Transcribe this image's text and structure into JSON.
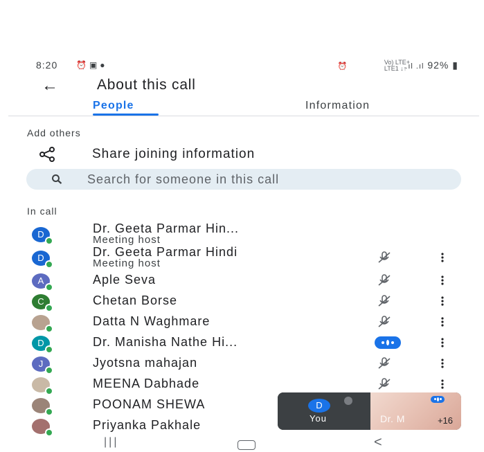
{
  "status_bar": {
    "time": "8:20",
    "left_icons": [
      "alarm-icon",
      "image-icon",
      "chat-icon"
    ],
    "network_top": "Vo) LTE+",
    "network_bottom": "LTE1 ↓↑",
    "battery": "92%"
  },
  "header": {
    "title": "About this call"
  },
  "tabs": [
    {
      "label": "People",
      "active": true
    },
    {
      "label": "Information",
      "active": false
    }
  ],
  "add_others": {
    "label": "Add others",
    "share_label": "Share joining information",
    "search_placeholder": "Search for someone in this call"
  },
  "in_call": {
    "label": "In call",
    "participants": [
      {
        "name": "Dr. Geeta Parmar Hin...",
        "role": "Meeting host",
        "avatar": "D",
        "avatar_color": "#1967d2",
        "mic": "none"
      },
      {
        "name": "Dr. Geeta Parmar Hindi",
        "role": "Meeting host",
        "avatar": "D",
        "avatar_color": "#1967d2",
        "mic": "muted"
      },
      {
        "name": "Aple Seva",
        "role": "",
        "avatar": "A",
        "avatar_color": "#5c6bc0",
        "mic": "muted"
      },
      {
        "name": "Chetan Borse",
        "role": "",
        "avatar": "C",
        "avatar_color": "#2e7d32",
        "mic": "muted"
      },
      {
        "name": "Datta N Waghmare",
        "role": "",
        "avatar": "",
        "avatar_color": "#b8a290",
        "mic": "muted"
      },
      {
        "name": "Dr. Manisha Nathe Hi...",
        "role": "",
        "avatar": "D",
        "avatar_color": "#0097a7",
        "mic": "speaking"
      },
      {
        "name": "Jyotsna mahajan",
        "role": "",
        "avatar": "J",
        "avatar_color": "#5c6bc0",
        "mic": "muted"
      },
      {
        "name": "MEENA Dabhade",
        "role": "",
        "avatar": "",
        "avatar_color": "#c9b9a6",
        "mic": "muted"
      },
      {
        "name": "POONAM SHEWA",
        "role": "",
        "avatar": "",
        "avatar_color": "#9b8478",
        "mic": "none"
      },
      {
        "name": "Priyanka Pakhale",
        "role": "",
        "avatar": "",
        "avatar_color": "#a3706e",
        "mic": "none"
      }
    ]
  },
  "self_tile": {
    "avatar": "D",
    "label": "You",
    "video_label": "Dr. M",
    "extra_count": "+16"
  },
  "colors": {
    "accent": "#1a73e8",
    "online": "#34a853",
    "search_bg": "#e4edf3"
  }
}
